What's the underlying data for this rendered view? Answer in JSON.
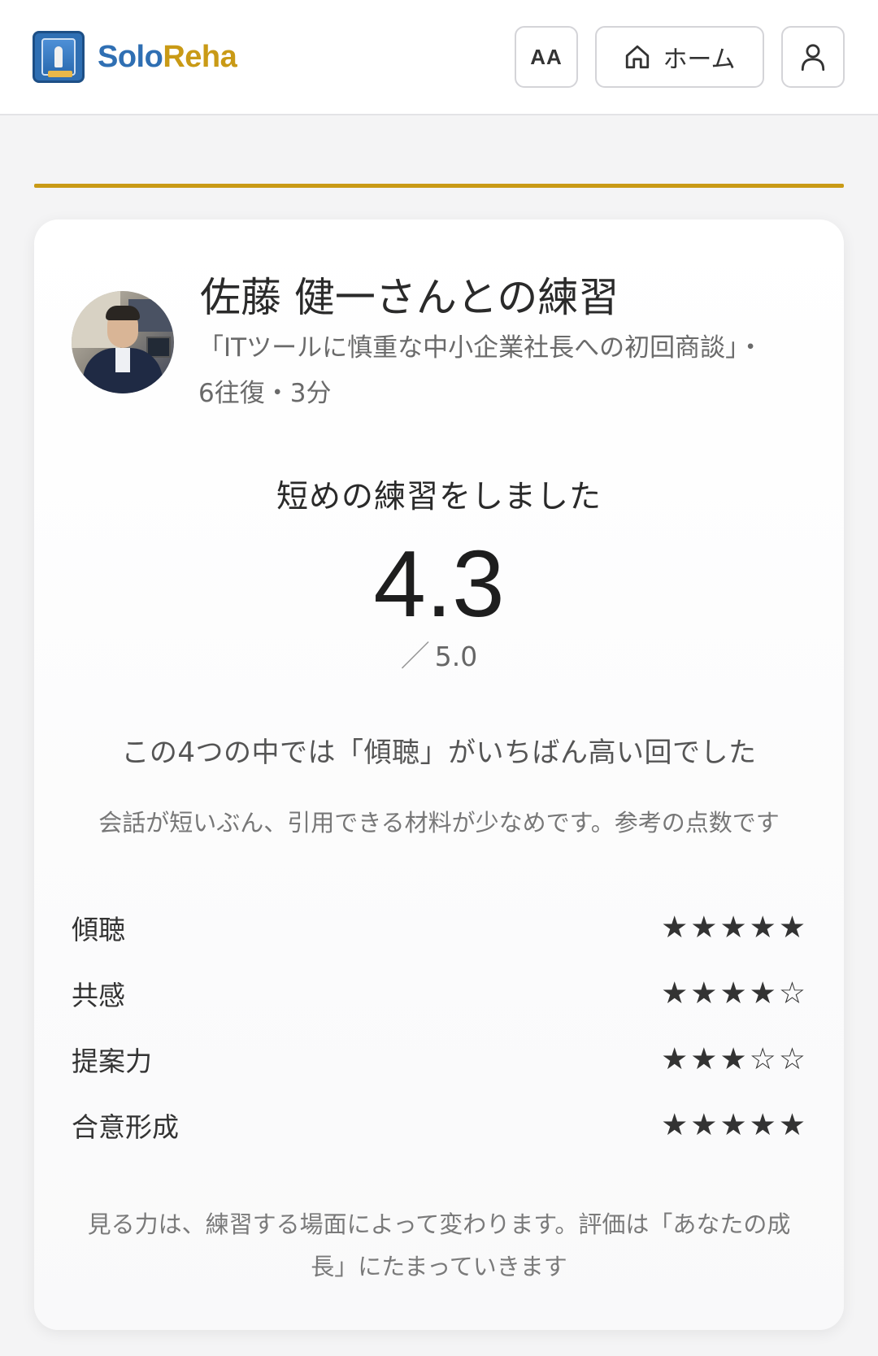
{
  "header": {
    "brand_part1": "Solo",
    "brand_part2": "Reha",
    "font_button_label": "AA",
    "home_button_label": "ホーム",
    "icons": [
      "logo-icon",
      "home-icon",
      "user-icon"
    ]
  },
  "colors": {
    "brand_blue": "#2f6fb3",
    "brand_gold": "#c99a16",
    "card_bg": "#ffffff",
    "page_bg": "#f4f4f5"
  },
  "practice": {
    "title": "佐藤 健一さんとの練習",
    "subtitle": "「ITツールに慎重な中小企業社長への初回商談」・6往復・3分",
    "headline": "短めの練習をしました",
    "score": "4.3",
    "max_score": "5.0",
    "max_prefix": "／",
    "best_summary": "この4つの中では「傾聴」がいちばん高い回でした",
    "short_note": "会話が短いぶん、引用できる材料が少なめです。参考の点数です"
  },
  "metrics": [
    {
      "label": "傾聴",
      "stars": "★★★★★",
      "rating": 5
    },
    {
      "label": "共感",
      "stars": "★★★★☆",
      "rating": 4
    },
    {
      "label": "提案力",
      "stars": "★★★☆☆",
      "rating": 3
    },
    {
      "label": "合意形成",
      "stars": "★★★★★",
      "rating": 5
    }
  ],
  "footer_note": "見る力は、練習する場面によって変わります。評価は「あなたの成長」にたまっていきます"
}
